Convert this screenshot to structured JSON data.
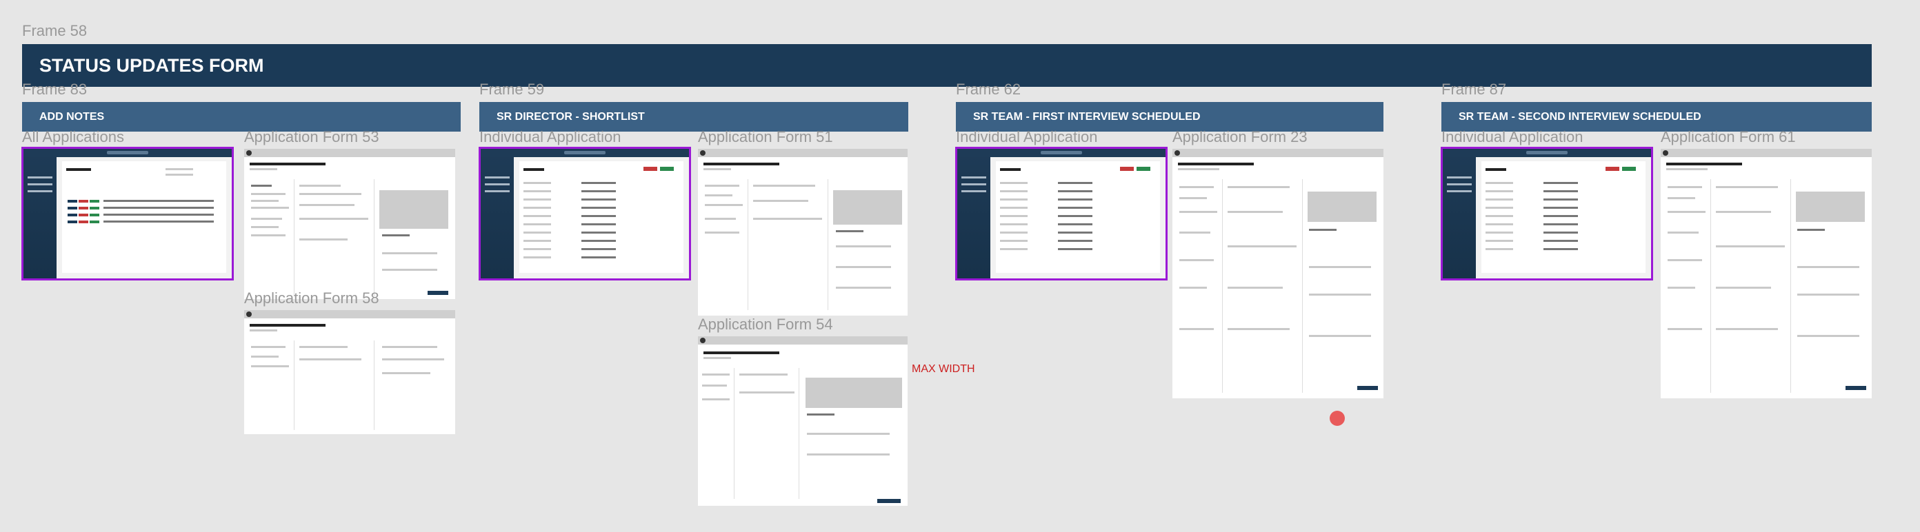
{
  "frame_title": "Frame 58",
  "banner_title": "STATUS UPDATES FORM",
  "sections": [
    {
      "frame": "Frame 83",
      "title": "ADD NOTES"
    },
    {
      "frame": "Frame 59",
      "title": "SR DIRECTOR - SHORTLIST"
    },
    {
      "frame": "Frame 62",
      "title": "SR TEAM - FIRST INTERVIEW SCHEDULED"
    },
    {
      "frame": "Frame 87",
      "title": "SR TEAM - SECOND INTERVIEW SCHEDULED"
    }
  ],
  "screens": {
    "all_applications": "All Applications",
    "app_form_53": "Application Form 53",
    "app_form_58": "Application Form 58",
    "individual_1": "Individual Application",
    "app_form_51": "Application Form 51",
    "app_form_54": "Application Form 54",
    "individual_2": "Individual Application",
    "app_form_23": "Application Form 23",
    "individual_3": "Individual Application",
    "app_form_61": "Application Form 61"
  },
  "annotation": "MAX WIDTH",
  "colors": {
    "banner": "#1b3a57",
    "section": "#3b6185",
    "selection": "#9b19d6",
    "annotation": "#cc1f1f"
  }
}
